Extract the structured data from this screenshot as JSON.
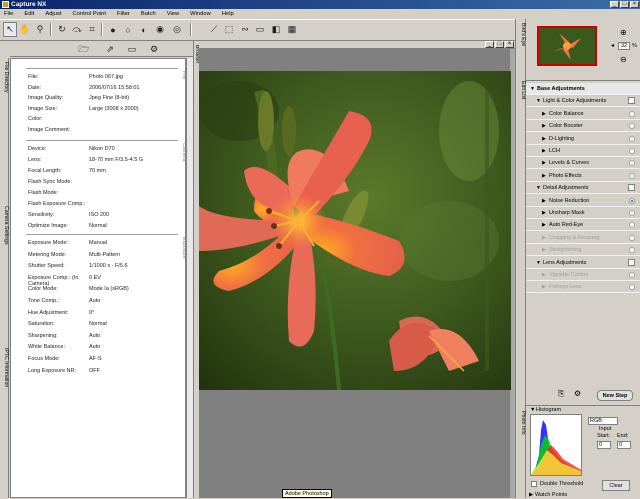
{
  "app": {
    "title": "Capture NX"
  },
  "menu": [
    "File",
    "Edit",
    "Adjust",
    "Control Point",
    "Filter",
    "Batch",
    "View",
    "Window",
    "Help"
  ],
  "left_tabs": [
    "File Directory",
    "Camera Settings",
    "IPTC Information"
  ],
  "info": {
    "file": [
      {
        "label": "File:",
        "value": "Photo 067.jpg"
      },
      {
        "label": "Date:",
        "value": "2006/07/16 15:58:01"
      },
      {
        "label": "Image Quality:",
        "value": "Jpeg Fine (8-bit)"
      },
      {
        "label": "Image Size:",
        "value": "Large (3008 x 2000)"
      },
      {
        "label": "Color:",
        "value": ""
      },
      {
        "label": "Image Comment:",
        "value": ""
      }
    ],
    "camera": [
      {
        "label": "Device:",
        "value": "Nikon D70"
      },
      {
        "label": "Lens:",
        "value": "18-70 mm F/3.5-4.5 G"
      },
      {
        "label": "Focal Length:",
        "value": "70 mm"
      },
      {
        "label": "Flash Sync Mode:",
        "value": ""
      },
      {
        "label": "Flash Mode:",
        "value": ""
      },
      {
        "label": "Flash Exposure Comp.:",
        "value": ""
      },
      {
        "label": "Sensitivity:",
        "value": "ISO 200"
      },
      {
        "label": "Optimize Image:",
        "value": "Normal"
      }
    ],
    "exposure": [
      {
        "label": "Exposure Mode:",
        "value": "Manual"
      },
      {
        "label": "Metering Mode:",
        "value": "Multi-Pattern"
      },
      {
        "label": "Shutter Speed:",
        "value": "1/1000 s - F/5.6"
      },
      {
        "label": "Exposure Comp.: (In Camera)",
        "value": "0 EV"
      },
      {
        "label": "Color Mode:",
        "value": "Mode Ia (sRGB)"
      },
      {
        "label": "Tone Comp.:",
        "value": "Auto"
      },
      {
        "label": "Hue Adjustment:",
        "value": "0°"
      },
      {
        "label": "Saturation:",
        "value": "Normal"
      },
      {
        "label": "Sharpening:",
        "value": "Auto"
      },
      {
        "label": "White Balance:",
        "value": "Auto"
      },
      {
        "label": "Focus Mode:",
        "value": "AF-S"
      },
      {
        "label": "Long Exposure NR:",
        "value": "OFF"
      }
    ],
    "section_labels": {
      "file": "File",
      "camera": "Camera",
      "exposure": "Exposure"
    }
  },
  "canvas": {
    "browser_tab": "Browser"
  },
  "tooltip": "Adobe Photoshop",
  "right_tabs": {
    "birdseye": "Bird's Eye",
    "edit_list": "Edit List",
    "photo_info": "Photo Info"
  },
  "birdseye": {
    "zoom": "32",
    "zoom_unit": "%"
  },
  "edit_list": {
    "items": [
      {
        "label": "Base Adjustments",
        "indent": 0,
        "kind": "head"
      },
      {
        "label": "Light & Color Adjustments",
        "indent": 1,
        "kind": "check"
      },
      {
        "label": "Color Balance",
        "indent": 2,
        "kind": "radio"
      },
      {
        "label": "Color Booster",
        "indent": 2,
        "kind": "radio"
      },
      {
        "label": "D-Lighting",
        "indent": 2,
        "kind": "radio"
      },
      {
        "label": "LCH",
        "indent": 2,
        "kind": "radio"
      },
      {
        "label": "Levels & Curves",
        "indent": 2,
        "kind": "radio"
      },
      {
        "label": "Photo Effects",
        "indent": 2,
        "kind": "radio"
      },
      {
        "label": "Detail Adjustments",
        "indent": 1,
        "kind": "check"
      },
      {
        "label": "Noise Reduction",
        "indent": 2,
        "kind": "radio-on"
      },
      {
        "label": "Unsharp Mask",
        "indent": 2,
        "kind": "radio"
      },
      {
        "label": "Auto Red-Eye",
        "indent": 2,
        "kind": "radio"
      },
      {
        "label": "Cropping & Resizing",
        "indent": 2,
        "kind": "dim"
      },
      {
        "label": "Straightening",
        "indent": 2,
        "kind": "dim"
      },
      {
        "label": "Lens Adjustments",
        "indent": 1,
        "kind": "check"
      },
      {
        "label": "Vignette Control",
        "indent": 2,
        "kind": "dim"
      },
      {
        "label": "Fisheye Lens",
        "indent": 2,
        "kind": "dim"
      }
    ],
    "new_step": "New Step"
  },
  "histogram": {
    "title": "Histogram",
    "channel": "RGB",
    "input_label": "Input",
    "start_label": "Start:",
    "end_label": "End:",
    "start": "0",
    "end": "0",
    "double_threshold": "Double Threshold",
    "clear": "Clear",
    "watch_points": "Watch Points"
  },
  "colors": {
    "title_start": "#0a246a",
    "title_end": "#3a6ea5",
    "accent": "#3040a0",
    "selection": "#c00000"
  }
}
